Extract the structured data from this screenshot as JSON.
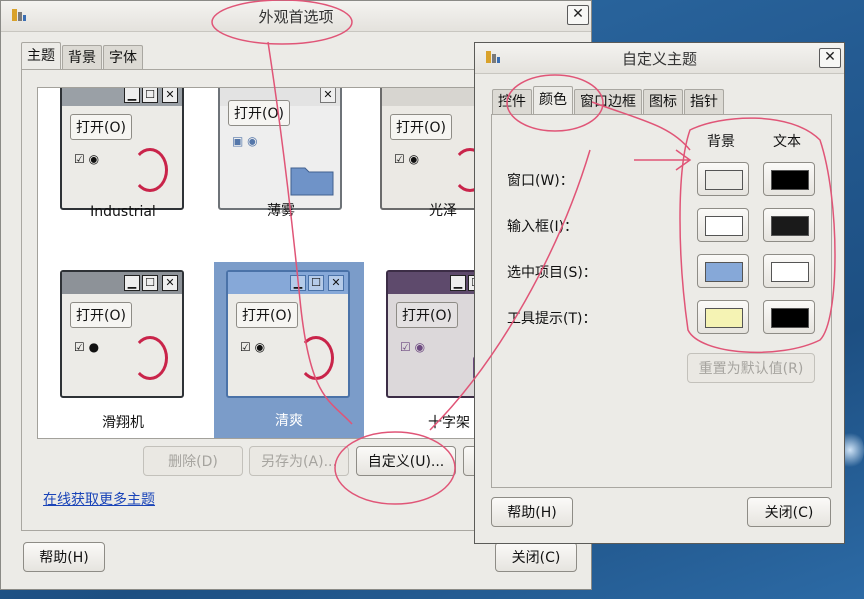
{
  "main_window": {
    "title": "外观首选项",
    "tabs": [
      "主题",
      "背景",
      "字体"
    ],
    "themes": [
      {
        "name": "Industrial",
        "open_label": "打开(O)"
      },
      {
        "name": "薄雾",
        "open_label": "打开(O)"
      },
      {
        "name": "光泽",
        "open_label": "打开(O)"
      },
      {
        "name": "滑翔机",
        "open_label": "打开(O)"
      },
      {
        "name": "清爽",
        "open_label": "打开(O)",
        "selected": true
      },
      {
        "name": "十字架",
        "open_label": "打开(O)"
      }
    ],
    "buttons": {
      "delete": "删除(D)",
      "save_as": "另存为(A)...",
      "customize": "自定义(U)...",
      "help": "帮助(H)",
      "close": "关闭(C)"
    },
    "online_link": "在线获取更多主题"
  },
  "custom_dialog": {
    "title": "自定义主题",
    "tabs": [
      "控件",
      "颜色",
      "窗口边框",
      "图标",
      "指针"
    ],
    "active_tab": "颜色",
    "column_headers": {
      "background": "背景",
      "text": "文本"
    },
    "rows": [
      {
        "label": "窗口(W)：",
        "bg_color": "#ecebe7",
        "text_color": "#000000"
      },
      {
        "label": "输入框(I)：",
        "bg_color": "#ffffff",
        "text_color": "#1a1a1a"
      },
      {
        "label": "选中项目(S)：",
        "bg_color": "#86a8d8",
        "text_color": "#ffffff"
      },
      {
        "label": "工具提示(T)：",
        "bg_color": "#f5f3b4",
        "text_color": "#000000"
      }
    ],
    "reset_button": "重置为默认值(R)",
    "help_button": "帮助(H)",
    "close_button": "关闭(C)"
  },
  "annotation_color": "#e05577"
}
